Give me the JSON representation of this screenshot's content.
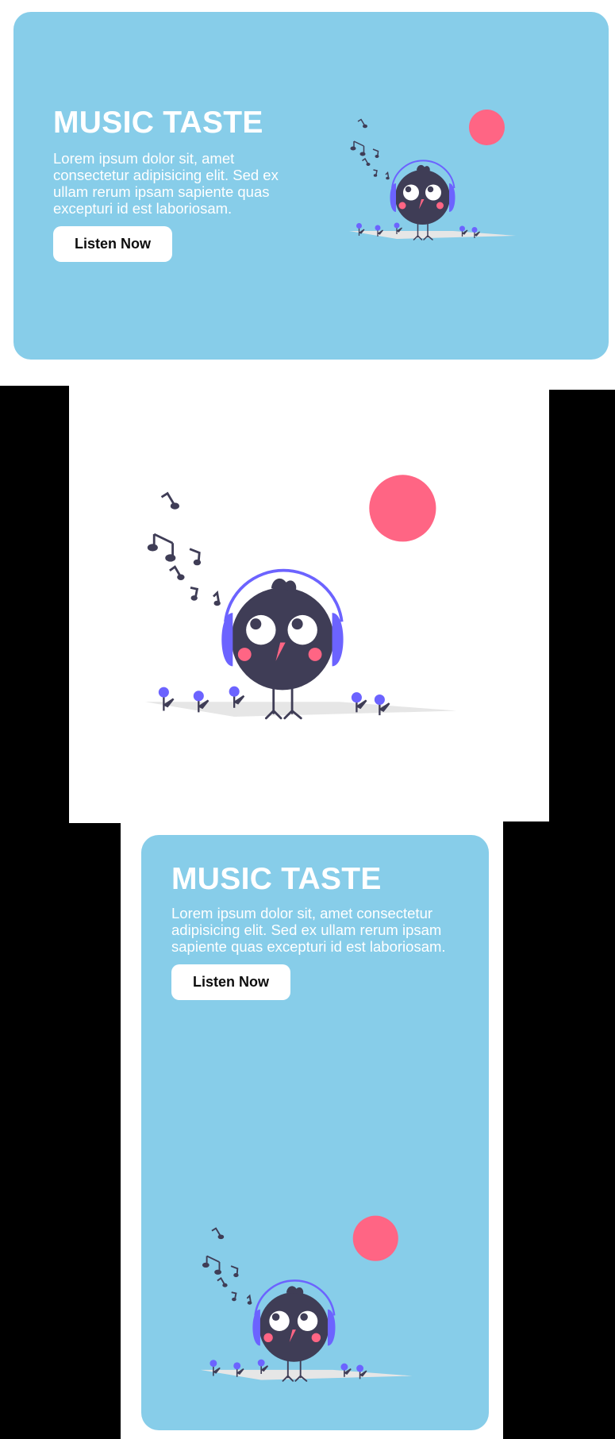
{
  "hero": {
    "title": "MUSIC TASTE",
    "description": "Lorem ipsum dolor sit, amet consectetur adipisicing elit. Sed ex ullam rerum ipsam sapiente quas excepturi id est laboriosam.",
    "cta_label": "Listen Now"
  },
  "mobile_hero": {
    "title": "MUSIC TASTE",
    "description": "Lorem ipsum dolor sit, amet consectetur adipisicing elit. Sed ex ullam rerum ipsam sapiente quas excepturi id est laboriosam.",
    "cta_label": "Listen Now"
  },
  "illustration": {
    "icon": "bird-with-headphones-icon",
    "colors": {
      "card_background": "#87CDE9",
      "sun": "#FF6584",
      "body": "#3F3D56",
      "headphones": "#6C63FF",
      "cheeks": "#FF6584",
      "beak": "#FF6584",
      "eyes": "#FFFFFF",
      "ground": "#E6E6E6",
      "flowers": "#6C63FF",
      "notes": "#3F3D56"
    }
  }
}
